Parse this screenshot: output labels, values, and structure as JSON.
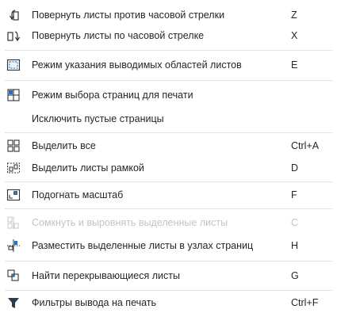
{
  "menu": {
    "items": [
      {
        "label": "Повернуть листы против часовой стрелки",
        "shortcut": "Z",
        "icon": "rotate-ccw-icon"
      },
      {
        "label": "Повернуть листы по часовой стрелке",
        "shortcut": "X",
        "icon": "rotate-cw-icon"
      },
      {
        "label": "Режим указания выводимых областей листов",
        "shortcut": "E",
        "icon": "print-area-mode-icon"
      },
      {
        "label": "Режим выбора страниц для печати",
        "shortcut": "",
        "icon": "page-select-mode-icon"
      },
      {
        "label": "Исключить пустые страницы",
        "shortcut": "",
        "icon": ""
      },
      {
        "label": "Выделить все",
        "shortcut": "Ctrl+A",
        "icon": "select-all-icon"
      },
      {
        "label": "Выделить листы рамкой",
        "shortcut": "D",
        "icon": "frame-select-icon"
      },
      {
        "label": "Подогнать масштаб",
        "shortcut": "F",
        "icon": "fit-scale-icon"
      },
      {
        "label": "Сомкнуть и выровнять выделенные листы",
        "shortcut": "C",
        "icon": "align-sheets-icon",
        "disabled": true
      },
      {
        "label": "Разместить выделенные листы в узлах страниц",
        "shortcut": "H",
        "icon": "place-at-nodes-icon"
      },
      {
        "label": "Найти перекрывающиеся листы",
        "shortcut": "G",
        "icon": "find-overlap-icon"
      },
      {
        "label": "Фильтры вывода на печать",
        "shortcut": "Ctrl+F",
        "icon": "filter-icon"
      }
    ]
  },
  "colors": {
    "text": "#262626",
    "disabled_text": "#c4c4c4",
    "separator": "#e2e2e2",
    "icon_dark": "#333333",
    "icon_accent": "#2b6fb6"
  }
}
